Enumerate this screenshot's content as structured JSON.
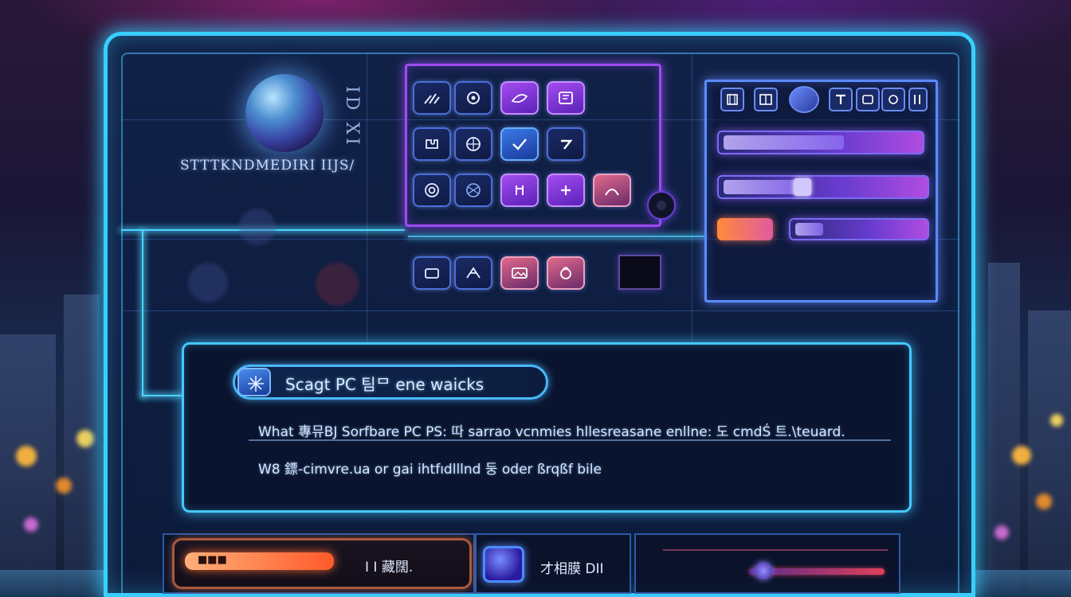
{
  "app": {
    "logo_vertical_text": "ID XI",
    "logo_title": "STTTKNDMEDIRI IIJS/"
  },
  "icon_grid": {
    "rows": [
      [
        "icon-tools",
        "icon-cycle",
        "icon-paint",
        "icon-book"
      ],
      [
        "icon-puzzle",
        "icon-globe",
        "icon-check",
        "icon-arrow"
      ],
      [
        "icon-target",
        "icon-mesh",
        "icon-tree",
        "icon-plus",
        "icon-spark"
      ],
      [
        "icon-box",
        "icon-spider",
        "icon-gallery",
        "icon-bag"
      ]
    ]
  },
  "controls": {
    "top_icons": [
      "icon-film",
      "icon-grid",
      "icon-sphere",
      "icon-type",
      "icon-layers",
      "icon-photo"
    ],
    "slider_1_level": 0.62,
    "slider_2_level": 0.4,
    "slider_3_level": 0.22,
    "accent_orange": "#ff8a3a"
  },
  "dialog": {
    "search_text": "Scagt PC 팀ᄆ ene waicks",
    "line_1": "What 專뮤BJ Sorfbare PC PS: 따 sarrao vcnmies hllesreasane enllne: 도 cmdŚ 트.\\teuard.",
    "line_2": "W8 鏢-cimvre.ua or gai ihtfıdlllnd 둥 oder ßrqßf bile"
  },
  "bottom_bar": {
    "progress_label": "■■■",
    "progress_level": 0.55,
    "left_text": "I I 藏闊.",
    "badge_text": "才相膜 DII",
    "slider_level": 0.05
  },
  "colors": {
    "frame": "#38cfff",
    "panel_purple": "#9c4cf2",
    "panel_blue": "#5a8cff"
  }
}
